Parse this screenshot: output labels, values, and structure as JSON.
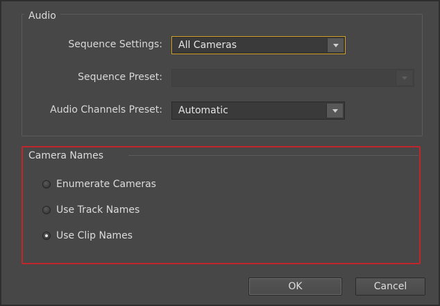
{
  "audio": {
    "legend": "Audio",
    "sequence_settings": {
      "label": "Sequence Settings:",
      "value": "All Cameras"
    },
    "sequence_preset": {
      "label": "Sequence Preset:",
      "value": ""
    },
    "audio_channels_preset": {
      "label": "Audio Channels Preset:",
      "value": "Automatic"
    }
  },
  "camera_names": {
    "legend": "Camera Names",
    "options": [
      {
        "label": "Enumerate Cameras",
        "selected": false
      },
      {
        "label": "Use Track Names",
        "selected": false
      },
      {
        "label": "Use Clip Names",
        "selected": true
      }
    ]
  },
  "buttons": {
    "ok": "OK",
    "cancel": "Cancel"
  },
  "colors": {
    "background": "#474747",
    "focus_border": "#d6a32a",
    "highlight_border": "#c0262b"
  }
}
